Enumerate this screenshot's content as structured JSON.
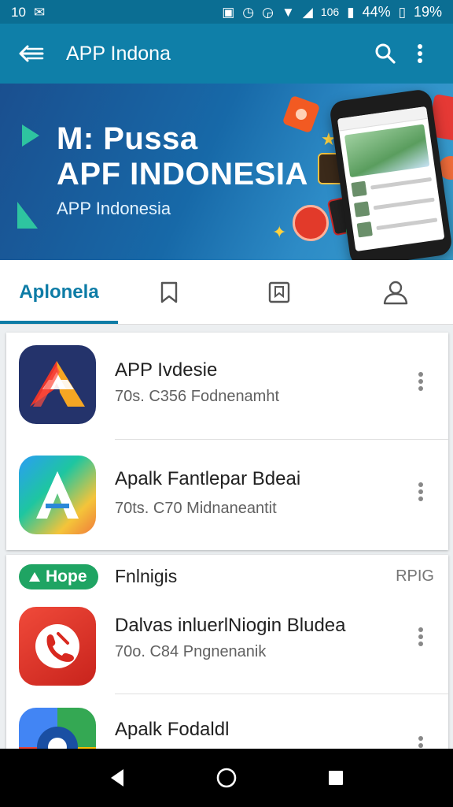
{
  "status_bar": {
    "left_text": "10",
    "right_text": "106",
    "battery_text": "44%",
    "battery_pct": "19%"
  },
  "app_bar": {
    "title": "APP Indona"
  },
  "banner": {
    "heading_line1": "M: Pussa",
    "heading_line2": "APF INDONESIA",
    "subheading": "APP Indonesia"
  },
  "tabs": [
    {
      "label": "Aplonela",
      "active": true,
      "icon": ""
    },
    {
      "label": "",
      "icon": "bookmark-icon"
    },
    {
      "label": "",
      "icon": "bookmark-icon"
    },
    {
      "label": "",
      "icon": "person-icon"
    }
  ],
  "list1": [
    {
      "name": "APP Ivdesie",
      "meta": "70s. C356 Fodnenamht",
      "icon": "app-red-a-icon"
    },
    {
      "name": "Apalk Fantlepar Bdeai",
      "meta": "70ts. C70 Midnaneantit",
      "icon": "app-rainbow-a-icon"
    }
  ],
  "section2": {
    "chip_label": "Hope",
    "title": "Fnlnigis",
    "right_label": "RPIG"
  },
  "list2": [
    {
      "name": "Dalvas inluerlNiogin Bludea",
      "meta": "70o. C84 Pngnenanik",
      "icon": "app-red-phone-icon"
    },
    {
      "name": "Apalk Fodaldl",
      "meta": "",
      "icon": "app-multicolor-icon"
    }
  ],
  "colors": {
    "app_bar": "#0f7fa8",
    "accent": "#0d7ca6",
    "chip_green": "#1fa463"
  }
}
